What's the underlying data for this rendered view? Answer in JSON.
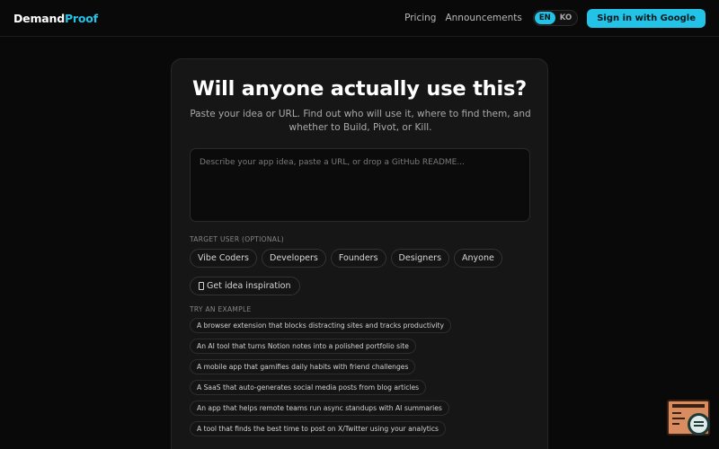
{
  "header": {
    "logo_part1": "Demand",
    "logo_part2": "Proof",
    "nav": [
      "Pricing",
      "Announcements"
    ],
    "languages": [
      "EN",
      "KO"
    ],
    "active_language": "EN",
    "signin_label": "Sign in with Google"
  },
  "main": {
    "title": "Will anyone actually use this?",
    "subtitle": "Paste your idea or URL. Find out who will use it, where to find them, and whether to Build, Pivot, or Kill.",
    "idea_input": {
      "value": "",
      "placeholder": "Describe your app idea, paste a URL, or drop a GitHub README..."
    },
    "target_user_label": "TARGET USER (OPTIONAL)",
    "target_users": [
      "Vibe Coders",
      "Developers",
      "Founders",
      "Designers",
      "Anyone"
    ],
    "inspiration_label": "Get idea inspiration",
    "examples_label": "TRY AN EXAMPLE",
    "examples": [
      "A browser extension that blocks distracting sites and tracks productivity",
      "An AI tool that turns Notion notes into a polished portfolio site",
      "A mobile app that gamifies daily habits with friend challenges",
      "A SaaS that auto-generates social media posts from blog articles",
      "An app that helps remote teams run async standups with AI summaries",
      "A tool that finds the best time to post on X/Twitter using your analytics"
    ]
  },
  "colors": {
    "accent": "#22c3e6",
    "background": "#090909",
    "card": "#161616"
  },
  "icons": {
    "inspiration": "lightbulb-icon",
    "widget": "feedback-magnifier-icon"
  }
}
